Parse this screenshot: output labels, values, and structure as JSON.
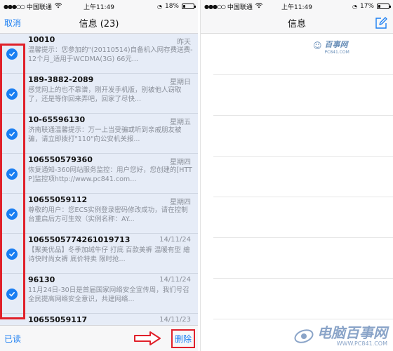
{
  "left": {
    "status": {
      "signal": "●●●○○",
      "carrier": "中国联通",
      "time": "上午11:49",
      "battery": "18%",
      "battery_level": 0.18
    },
    "nav": {
      "cancel": "取消",
      "title": "信息 (23)"
    },
    "messages": [
      {
        "sender": "10010",
        "date": "昨天",
        "preview": "温馨提示：您参加的\"(20110514)自备机入网存费送费-12个月_适用于WCDMA(3G) 66元..."
      },
      {
        "sender": "189-3882-2089",
        "date": "星期日",
        "preview": "感觉网上的也不靠谱，刚开发手机版，别被他人窃取了，还是等你回来弄吧，回家了尽快..."
      },
      {
        "sender": "10-65596130",
        "date": "星期五",
        "preview": "济南联通温馨提示：万一上当受骗或听到亲戚朋友被骗，请立即拨打\"110\"向公安机关报..."
      },
      {
        "sender": "106550579360",
        "date": "星期四",
        "preview": "恢复通知-360网站服务监控：用户您好，您创建的[HTTP]监控项http://www.pc841.com..."
      },
      {
        "sender": "10655059112",
        "date": "星期四",
        "preview": "尊敬的用户：您ECS实例登录密码修改成功，请在控制台重启后方可生效（实例名称：AY..."
      },
      {
        "sender": "1065505774261019713",
        "date": "14/11/24",
        "preview": "【聚美优品】冬季加绒牛仔 打底 百款美裤 温暖有型 繪诗快时尚女裤  底价特卖 限时抢..."
      },
      {
        "sender": "96130",
        "date": "14/11/24",
        "preview": "11月24日-30日是首届国家网络安全宣传周，我们号召全民提高网络安全意识，共建网络..."
      },
      {
        "sender": "10655059117",
        "date": "14/11/23",
        "preview": ""
      }
    ],
    "toolbar": {
      "read": "已读",
      "delete": "删除"
    }
  },
  "right": {
    "status": {
      "signal": "●●●○○",
      "carrier": "中国联通",
      "time": "上午11:49",
      "battery": "17%",
      "battery_level": 0.17
    },
    "nav": {
      "title": "信息"
    },
    "watermark_small": {
      "brand": "百事网",
      "url": "PC841.COM"
    },
    "watermark_big": {
      "brand": "电脑百事网",
      "url": "WWW.PC841.COM"
    }
  },
  "colors": {
    "accent": "#1a7ef2",
    "highlight": "#e0202a",
    "selected_row": "#e6ecf7"
  }
}
